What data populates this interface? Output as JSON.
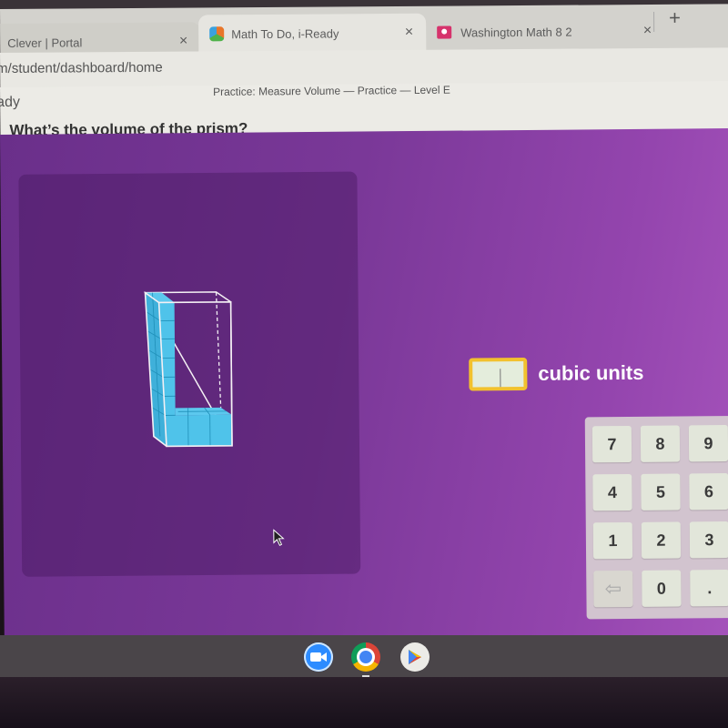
{
  "browser": {
    "tabs": [
      {
        "title": "Clever | Portal",
        "favicon": "clever-icon",
        "active": false
      },
      {
        "title": "Math To Do, i-Ready",
        "favicon": "iready-cube-icon",
        "active": true
      },
      {
        "title": "Washington Math 8 2",
        "favicon": "google-classroom-icon",
        "active": false
      }
    ],
    "close_glyph": "×",
    "new_tab_glyph": "+",
    "url": "m/student/dashboard/home"
  },
  "page": {
    "brand": "ady",
    "breadcrumb": "Practice: Measure Volume — Practice — Level E",
    "question": "What’s the volume of the prism?"
  },
  "answer": {
    "value": "",
    "unit_label": "cubic units"
  },
  "keypad": {
    "keys": [
      "7",
      "8",
      "9",
      "4",
      "5",
      "6",
      "1",
      "2",
      "3",
      "⇦",
      "0",
      "."
    ]
  },
  "figure": {
    "description": "L-shaped arrangement of unit cubes inside a rectangular prism outline",
    "cube_color": "#4fc3ea",
    "outline_color": "#f2f2f2"
  },
  "shelf": {
    "apps": [
      "zoom-icon",
      "chrome-icon",
      "play-store-icon"
    ]
  },
  "colors": {
    "main_bg": "#7a3898",
    "input_border": "#f2c12e",
    "keypad_bg": "#d2c4cf"
  }
}
